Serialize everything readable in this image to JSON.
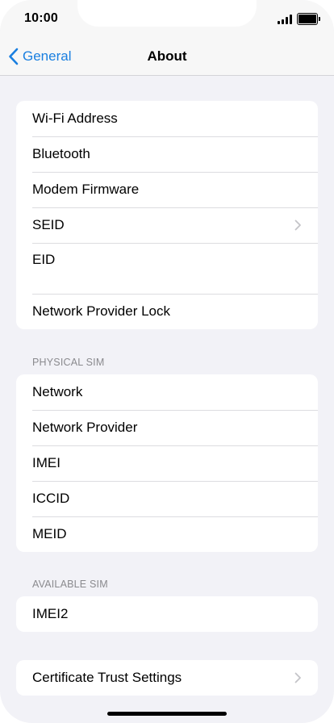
{
  "status_bar": {
    "time": "10:00",
    "icons": [
      "signal-icon",
      "battery-icon"
    ]
  },
  "nav": {
    "back_label": "General",
    "back_icon": "chevron-left-icon",
    "title": "About",
    "accent_color": "#1a7fe0"
  },
  "groups": {
    "main": {
      "items": [
        {
          "label": "Wi-Fi Address"
        },
        {
          "label": "Bluetooth"
        },
        {
          "label": "Modem Firmware"
        },
        {
          "label": "SEID",
          "icon": "chevron-right-icon"
        },
        {
          "label": "EID"
        },
        {
          "label": "Network Provider Lock"
        }
      ]
    },
    "physical_sim": {
      "header": "PHYSICAL SIM",
      "items": [
        {
          "label": "Network"
        },
        {
          "label": "Network Provider"
        },
        {
          "label": "IMEI"
        },
        {
          "label": "ICCID"
        },
        {
          "label": "MEID"
        }
      ]
    },
    "available_sim": {
      "header": "AVAILABLE SIM",
      "items": [
        {
          "label": "IMEI2"
        }
      ]
    },
    "certificates": {
      "items": [
        {
          "label": "Certificate Trust Settings",
          "icon": "chevron-right-icon"
        }
      ]
    }
  }
}
